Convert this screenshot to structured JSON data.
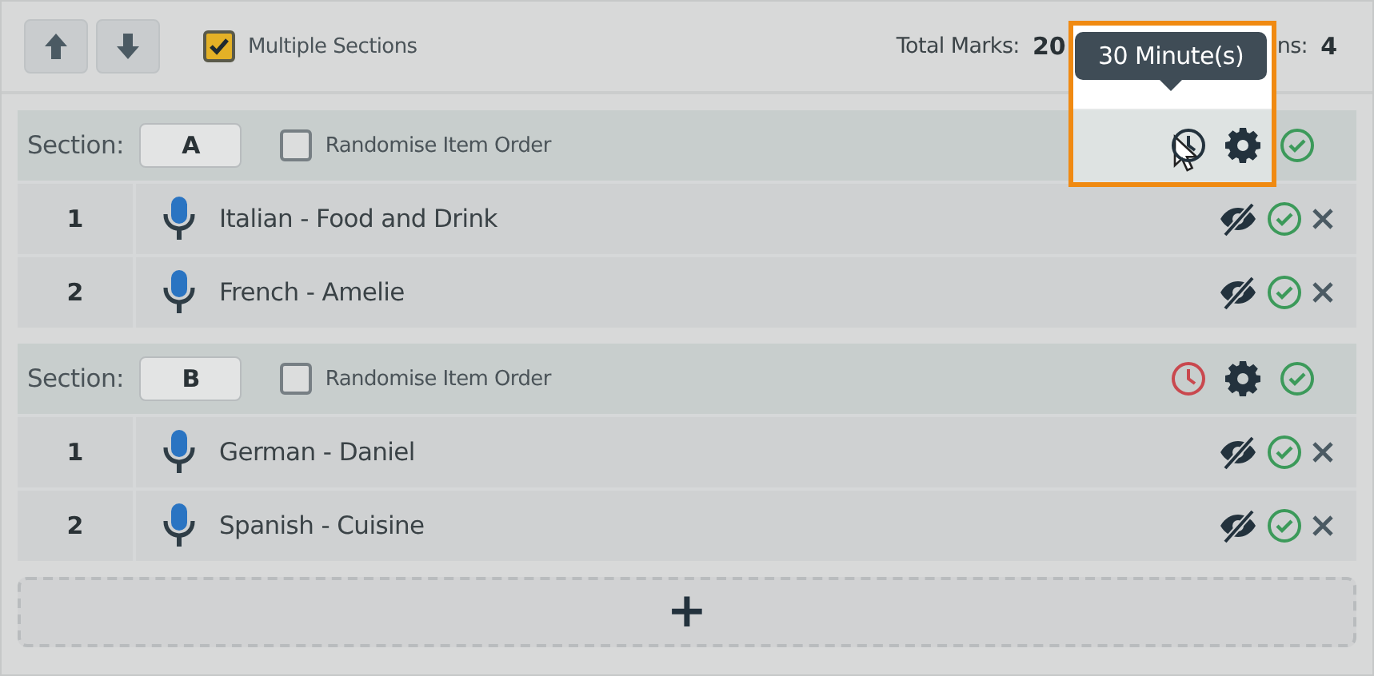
{
  "toolbar": {
    "multiple_sections": {
      "label": "Multiple Sections",
      "checked": true
    },
    "stats": [
      {
        "label": "Total Marks:",
        "value": "20"
      },
      {
        "label": "ns:",
        "value": "4"
      }
    ]
  },
  "tooltip": {
    "text": "30 Minute(s)"
  },
  "sections": [
    {
      "label": "Section:",
      "name": "A",
      "randomise": {
        "label": "Randomise Item Order",
        "checked": false
      },
      "timer_set": false,
      "highlighted": true,
      "items": [
        {
          "number": "1",
          "title": "Italian - Food and Drink"
        },
        {
          "number": "2",
          "title": "French - Amelie"
        }
      ]
    },
    {
      "label": "Section:",
      "name": "B",
      "randomise": {
        "label": "Randomise Item Order",
        "checked": false
      },
      "timer_set": true,
      "highlighted": false,
      "items": [
        {
          "number": "1",
          "title": "German - Daniel"
        },
        {
          "number": "2",
          "title": "Spanish - Cuisine"
        }
      ]
    }
  ],
  "add_button": {
    "text": "+"
  }
}
